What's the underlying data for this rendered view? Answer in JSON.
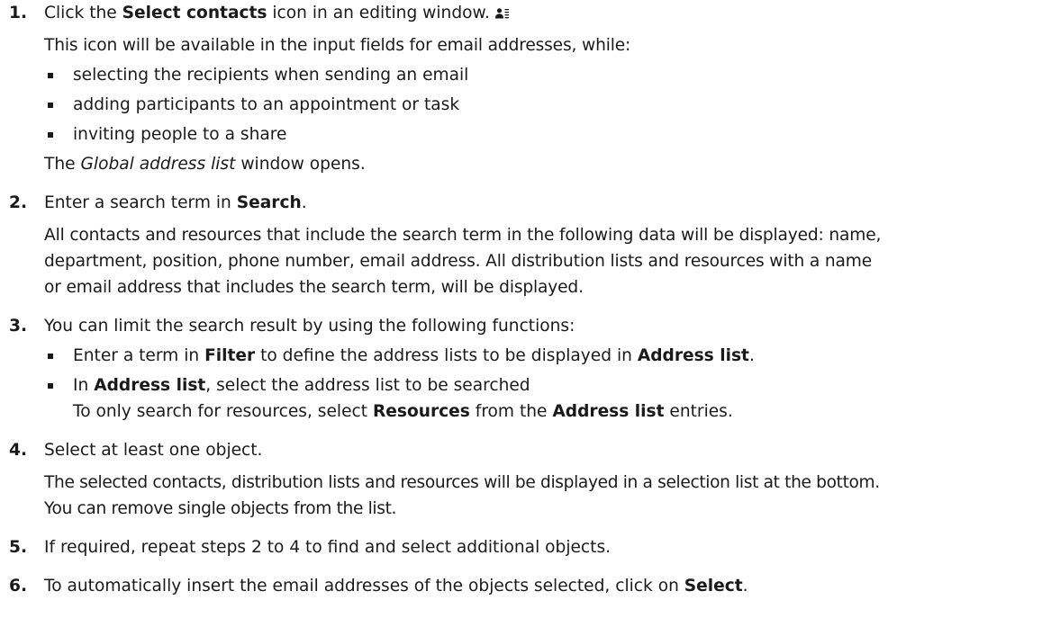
{
  "steps": [
    {
      "num": "1.",
      "a1": "Click the ",
      "b1": "Select contacts",
      "a2": " icon in an editing window.",
      "icon": "select-contacts-icon",
      "p1": "This icon will be available in the input fields for email addresses, while:",
      "bullets": [
        "selecting the recipients when sending an email",
        "adding participants to an appointment or task",
        "inviting people to a share"
      ],
      "p2a": "The ",
      "p2i": "Global address list",
      "p2b": " window opens."
    },
    {
      "num": "2.",
      "a1": "Enter a search term in ",
      "b1": "Search",
      "a2": ".",
      "p1l1": "All contacts and resources that include the search term in the following data will be displayed: name,",
      "p1l2": "department, position, phone number, email address. All distribution lists and resources with a name",
      "p1l3": "or email address that includes the search term, will be displayed."
    },
    {
      "num": "3.",
      "line": "You can limit the search result by using the following functions:",
      "b1a": "Enter a term in ",
      "b1b": "Filter",
      "b1c": " to define the address lists to be displayed in ",
      "b1d": "Address list",
      "b1e": ".",
      "b2a": "In ",
      "b2b": "Address list",
      "b2c": ", select the address list to be searched",
      "b2d": "To only search for resources, select ",
      "b2e": "Resources",
      "b2f": " from the ",
      "b2g": "Address list",
      "b2h": " entries."
    },
    {
      "num": "4.",
      "line": "Select at least one object.",
      "p1l1": "The selected contacts, distribution lists and resources will be displayed in a selection list at the bottom.",
      "p1l2": "You can remove single objects from the list."
    },
    {
      "num": "5.",
      "line": "If required, repeat steps 2 to 4 to find and select additional objects."
    },
    {
      "num": "6.",
      "a1": "To automatically insert the email addresses of the objects selected, click on ",
      "b1": "Select",
      "a2": "."
    }
  ]
}
